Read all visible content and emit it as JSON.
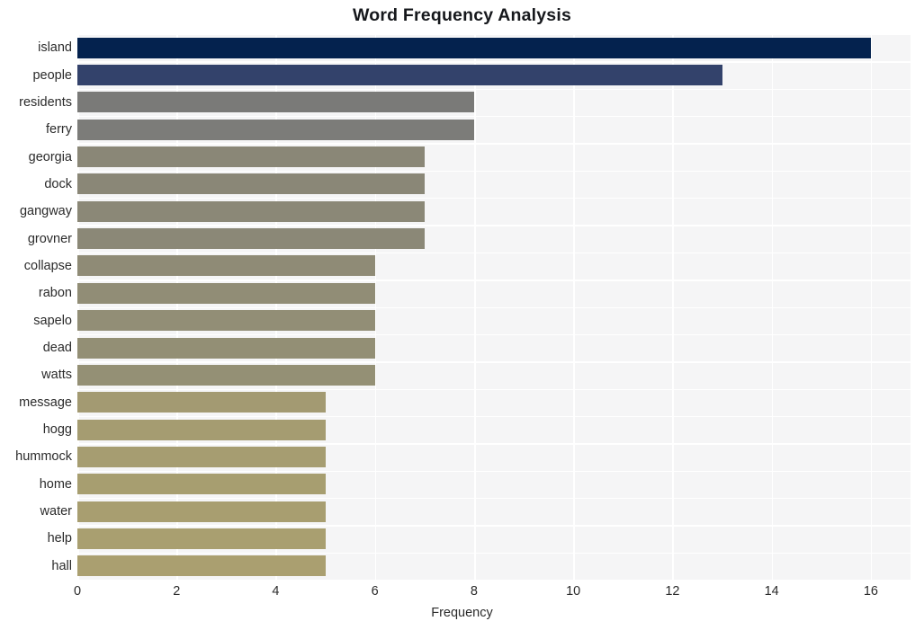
{
  "chart_data": {
    "type": "bar",
    "orientation": "horizontal",
    "title": "Word Frequency Analysis",
    "xlabel": "Frequency",
    "ylabel": "",
    "xlim": [
      0,
      16.8
    ],
    "ylim": [
      0,
      20
    ],
    "grid": true,
    "legend": null,
    "xticks": [
      0,
      2,
      4,
      6,
      8,
      10,
      12,
      14,
      16
    ],
    "xtick_labels": [
      "0",
      "2",
      "4",
      "6",
      "8",
      "10",
      "12",
      "14",
      "16"
    ],
    "categories": [
      "island",
      "people",
      "residents",
      "ferry",
      "georgia",
      "dock",
      "gangway",
      "grovner",
      "collapse",
      "rabon",
      "sapelo",
      "dead",
      "watts",
      "message",
      "hogg",
      "hummock",
      "home",
      "water",
      "help",
      "hall"
    ],
    "values": [
      16,
      13,
      8,
      8,
      7,
      7,
      7,
      7,
      6,
      6,
      6,
      6,
      6,
      5,
      5,
      5,
      5,
      5,
      5,
      5
    ],
    "bar_colors": [
      "#04224e",
      "#33426b",
      "#7a7a78",
      "#7c7c79",
      "#8a8777",
      "#8a8777",
      "#8b8877",
      "#8b8877",
      "#8f8b76",
      "#918d76",
      "#928e76",
      "#938f75",
      "#949075",
      "#a39a72",
      "#a59c71",
      "#a69d71",
      "#a79e70",
      "#a89e70",
      "#a99f70",
      "#aa9f70"
    ],
    "plot_background": "#f5f5f6",
    "grid_color": "#ffffff",
    "title_color": "#16181c",
    "tick_color": "#2b2b2b"
  }
}
